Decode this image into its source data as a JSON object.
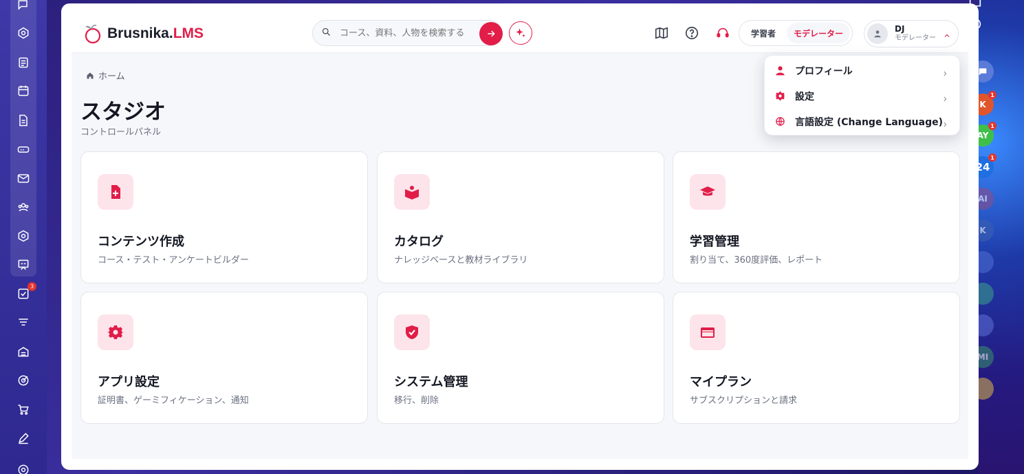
{
  "app": {
    "logo_main": "Brusnika.",
    "logo_accent": "LMS"
  },
  "search": {
    "placeholder": "コース、資料、人物を検索する"
  },
  "roles": {
    "learner": "学習者",
    "moderator": "モデレーター"
  },
  "user": {
    "initials": "DJ",
    "role": "モデレーター"
  },
  "breadcrumb": {
    "home": "ホーム"
  },
  "page": {
    "title": "スタジオ",
    "subtitle": "コントロールパネル"
  },
  "cards": [
    {
      "title": "コンテンツ作成",
      "desc": "コース・テスト・アンケートビルダー",
      "icon": "file-plus-icon"
    },
    {
      "title": "カタログ",
      "desc": "ナレッジベースと教材ライブラリ",
      "icon": "book-open-icon"
    },
    {
      "title": "学習管理",
      "desc": "割り当て、360度評価、レポート",
      "icon": "graduation-cap-icon"
    },
    {
      "title": "アプリ設定",
      "desc": "証明書、ゲーミフィケーション、通知",
      "icon": "gear-icon"
    },
    {
      "title": "システム管理",
      "desc": "移行、削除",
      "icon": "shield-check-icon"
    },
    {
      "title": "マイプラン",
      "desc": "サブスクリプションと請求",
      "icon": "credit-card-icon"
    }
  ],
  "dropdown": {
    "items": [
      {
        "label": "プロフィール",
        "icon": "person-icon"
      },
      {
        "label": "設定",
        "icon": "gear-icon"
      },
      {
        "label": "言語設定 (Change Language)",
        "icon": "globe-icon"
      }
    ]
  },
  "left_dock": {
    "badges": {
      "tasks": "3"
    }
  },
  "right_dock": {
    "avatars": [
      {
        "label": "K",
        "badge": "1",
        "color": "#e0552b"
      },
      {
        "label": "AY",
        "badge": "1",
        "color": "#3fbf4a"
      },
      {
        "label": "24",
        "badge": "1",
        "color": "#1f6fe0"
      },
      {
        "label": "AI",
        "badge": "",
        "color": "#8a4d8a"
      },
      {
        "label": "K",
        "badge": "",
        "color": "#3d5fb0"
      },
      {
        "label": "MI",
        "badge": "",
        "color": "#3a8a6a"
      }
    ]
  },
  "colors": {
    "accent": "#e11d48",
    "accent_soft": "#fde4ea"
  }
}
